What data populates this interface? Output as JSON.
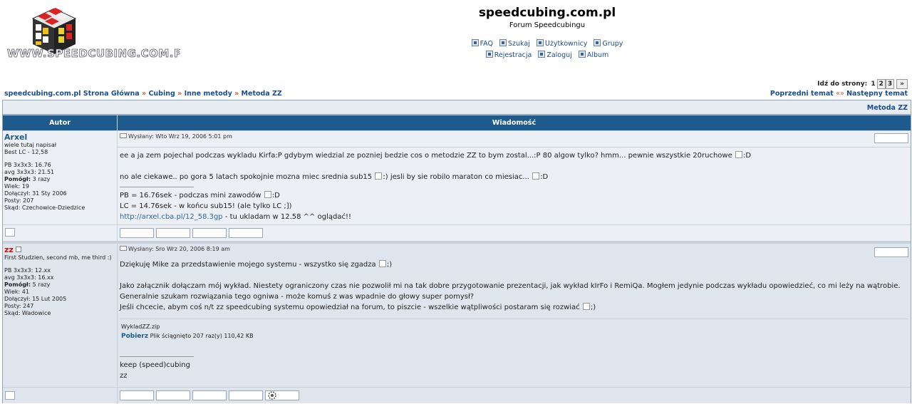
{
  "header": {
    "logo_text": "WWW.SPEEDCUBING.COM.PL",
    "site_title": "speedcubing.com.pl",
    "site_desc": "Forum Speedcubingu",
    "nav_row1": [
      "FAQ",
      "Szukaj",
      "Użytkownicy",
      "Grupy"
    ],
    "nav_row2": [
      "Rejestracja",
      "Zaloguj",
      "Album"
    ]
  },
  "pagination": {
    "label": "Idź do strony:",
    "pages": [
      "1",
      "2",
      "3"
    ],
    "next": "»"
  },
  "breadcrumb": {
    "items": [
      "speedcubing.com.pl Strona Główna",
      "Cubing",
      "Inne metody",
      "Metoda ZZ"
    ],
    "sep": "»"
  },
  "prevnext": {
    "prev": "Poprzedni temat",
    "sep": "«»",
    "next": "Następny temat"
  },
  "topic": {
    "title": "Metoda ZZ",
    "col_author": "Autor",
    "col_message": "Wiadomość"
  },
  "posts": [
    {
      "author": "Arxel",
      "rank": "wiele tutaj napisał",
      "info1": "Best LC - 12,58",
      "info2": [
        "PB 3x3x3: 16.76",
        "avg 3x3x3: 21.51"
      ],
      "pomogl": "Pomógł:",
      "pomogl_val": "3 razy",
      "age": "Wiek: 19",
      "joined": "Dołączył: 31 Sty 2006",
      "posts": "Posty: 207",
      "from": "Skąd: Czechowice-Dziedzice",
      "posted": "Wysłany: Wto Wrz 19, 2006 5:01 pm",
      "p1": "ee a ja zem pojechal podczas wykladu Kirfa:P gdybym wiedzial ze pozniej bedzie cos o metodzie ZZ to bym zostal...:P 80 algow tylko? hmm... pewnie wszystkie 20ruchowe",
      "p1_smiley": ":D",
      "p2a": "no ale ciekawe.. po gora 5 latach spokojnie mozna miec srednia sub15",
      "p2_smiley1": ":)",
      "p2b": "jesli by sie robilo maraton co miesiac...",
      "p2_smiley2": ":D",
      "sig1": "PB = 16.76sek - podczas mini zawodów",
      "sig1_smiley": ":D",
      "sig2": "LC = 14.76sek - w końcu sub15! (ale tylko LC ;])",
      "sig3_link": "http://arxel.cba.pl/12_58.3gp",
      "sig3_rest": " - tu ukladam w 12.58 ^^ oglądać!!"
    },
    {
      "author": "zz",
      "rank": "First Studzien, second mb, me third :)",
      "info2": [
        "PB 3x3x3: 12.xx",
        "avg 3x3x3: 16.xx"
      ],
      "pomogl": "Pomógł:",
      "pomogl_val": "5 razy",
      "age": "Wiek: 41",
      "joined": "Dołączył: 15 Lut 2005",
      "posts": "Posty: 247",
      "from": "Skąd: Wadowice",
      "posted": "Wysłany: Sro Wrz 20, 2006 8:19 am",
      "p1": "Dziękuję Mike za przedstawienie mojego systemu - wszystko się zgadza",
      "p1_smiley": ";)",
      "p2": "Jako załącznik dołączam mój wykład. Niestety ograniczony czas nie pozwolił mi na tak dobre przygotowanie prezentacji, jak wykład kIrFo i RemiQa. Mogłem jedynie podczas wykładu opowiedzieć, co mi leży na wątrobie.",
      "p3": "Generalnie szukam rozwiązania tego ogniwa - może komuś z was wpadnie do głowy super pomysł?",
      "p4": "Jeśli chcecie, abym coś n/t zz speedcubing systemu opowiedział na forum, to piszcie - wszelkie wątpliwości postaram się rozwiać",
      "p4_smiley": ";)",
      "attach_name": "WykladZZ.zip",
      "attach_dl": "Pobierz",
      "attach_info": "Plik ściągnięto 207 raz(y) 110,42 KB",
      "sig1": "keep (speed)cubing",
      "sig2": "zz"
    }
  ]
}
